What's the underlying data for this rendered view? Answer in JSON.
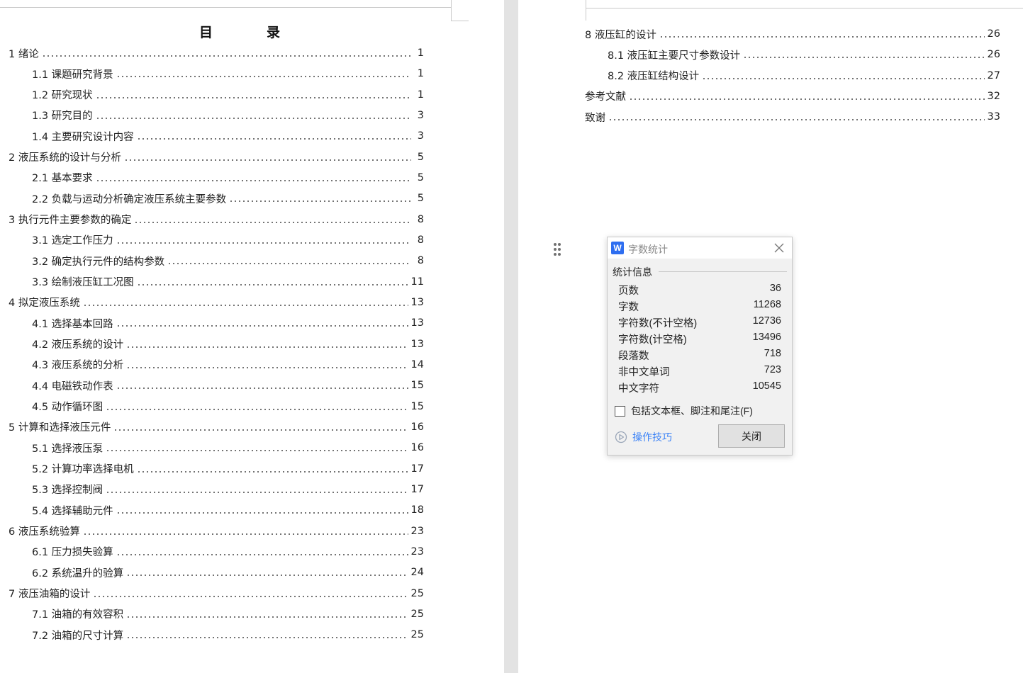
{
  "toc": {
    "title_chars": [
      "目",
      "录"
    ],
    "left_entries": [
      {
        "label": "1 绪论",
        "page": "1",
        "level": 1
      },
      {
        "label": "1.1 课题研究背景",
        "page": "1",
        "level": 2
      },
      {
        "label": "1.2 研究现状",
        "page": "1",
        "level": 2
      },
      {
        "label": "1.3 研究目的",
        "page": "3",
        "level": 2
      },
      {
        "label": "1.4 主要研究设计内容",
        "page": "3",
        "level": 2
      },
      {
        "label": "2 液压系统的设计与分析",
        "page": "5",
        "level": 1
      },
      {
        "label": "2.1 基本要求",
        "page": "5",
        "level": 2
      },
      {
        "label": "2.2 负载与运动分析确定液压系统主要参数",
        "page": "5",
        "level": 2
      },
      {
        "label": "3 执行元件主要参数的确定",
        "page": "8",
        "level": 1
      },
      {
        "label": "3.1 选定工作压力",
        "page": "8",
        "level": 2
      },
      {
        "label": "3.2 确定执行元件的结构参数",
        "page": "8",
        "level": 2
      },
      {
        "label": "3.3 绘制液压缸工况图",
        "page": "11",
        "level": 2
      },
      {
        "label": "4 拟定液压系统",
        "page": "13",
        "level": 1
      },
      {
        "label": "4.1 选择基本回路",
        "page": "13",
        "level": 2
      },
      {
        "label": "4.2 液压系统的设计",
        "page": "13",
        "level": 2
      },
      {
        "label": "4.3 液压系统的分析",
        "page": "14",
        "level": 2
      },
      {
        "label": "4.4 电磁铁动作表",
        "page": "15",
        "level": 2
      },
      {
        "label": "4.5 动作循环图",
        "page": "15",
        "level": 2
      },
      {
        "label": "5 计算和选择液压元件",
        "page": "16",
        "level": 1
      },
      {
        "label": "5.1 选择液压泵",
        "page": "16",
        "level": 2
      },
      {
        "label": "5.2 计算功率选择电机",
        "page": "17",
        "level": 2
      },
      {
        "label": "5.3 选择控制阀",
        "page": "17",
        "level": 2
      },
      {
        "label": "5.4 选择辅助元件",
        "page": "18",
        "level": 2
      },
      {
        "label": "6 液压系统验算",
        "page": "23",
        "level": 1
      },
      {
        "label": "6.1 压力损失验算",
        "page": "23",
        "level": 2
      },
      {
        "label": "6.2 系统温升的验算",
        "page": "24",
        "level": 2
      },
      {
        "label": "7 液压油箱的设计",
        "page": "25",
        "level": 1
      },
      {
        "label": "7.1 油箱的有效容积",
        "page": "25",
        "level": 2
      },
      {
        "label": "7.2 油箱的尺寸计算",
        "page": "25",
        "level": 2
      }
    ],
    "right_entries": [
      {
        "label": "8 液压缸的设计",
        "page": "26",
        "level": 1
      },
      {
        "label": "8.1 液压缸主要尺寸参数设计",
        "page": "26",
        "level": 2
      },
      {
        "label": "8.2 液压缸结构设计",
        "page": "27",
        "level": 2
      },
      {
        "label": "参考文献",
        "page": "32",
        "level": 1
      },
      {
        "label": "致谢",
        "page": "33",
        "level": 1
      }
    ]
  },
  "dialog": {
    "logo_letter": "W",
    "title": "字数统计",
    "group_label": "统计信息",
    "stats": [
      {
        "label": "页数",
        "value": "36"
      },
      {
        "label": "字数",
        "value": "11268"
      },
      {
        "label": "字符数(不计空格)",
        "value": "12736"
      },
      {
        "label": "字符数(计空格)",
        "value": "13496"
      },
      {
        "label": "段落数",
        "value": "718"
      },
      {
        "label": "非中文单词",
        "value": "723"
      },
      {
        "label": "中文字符",
        "value": "10545"
      }
    ],
    "checkbox_label": "包括文本框、脚注和尾注(F)",
    "checkbox_checked": false,
    "tips_label": "操作技巧",
    "close_button_label": "关闭"
  }
}
